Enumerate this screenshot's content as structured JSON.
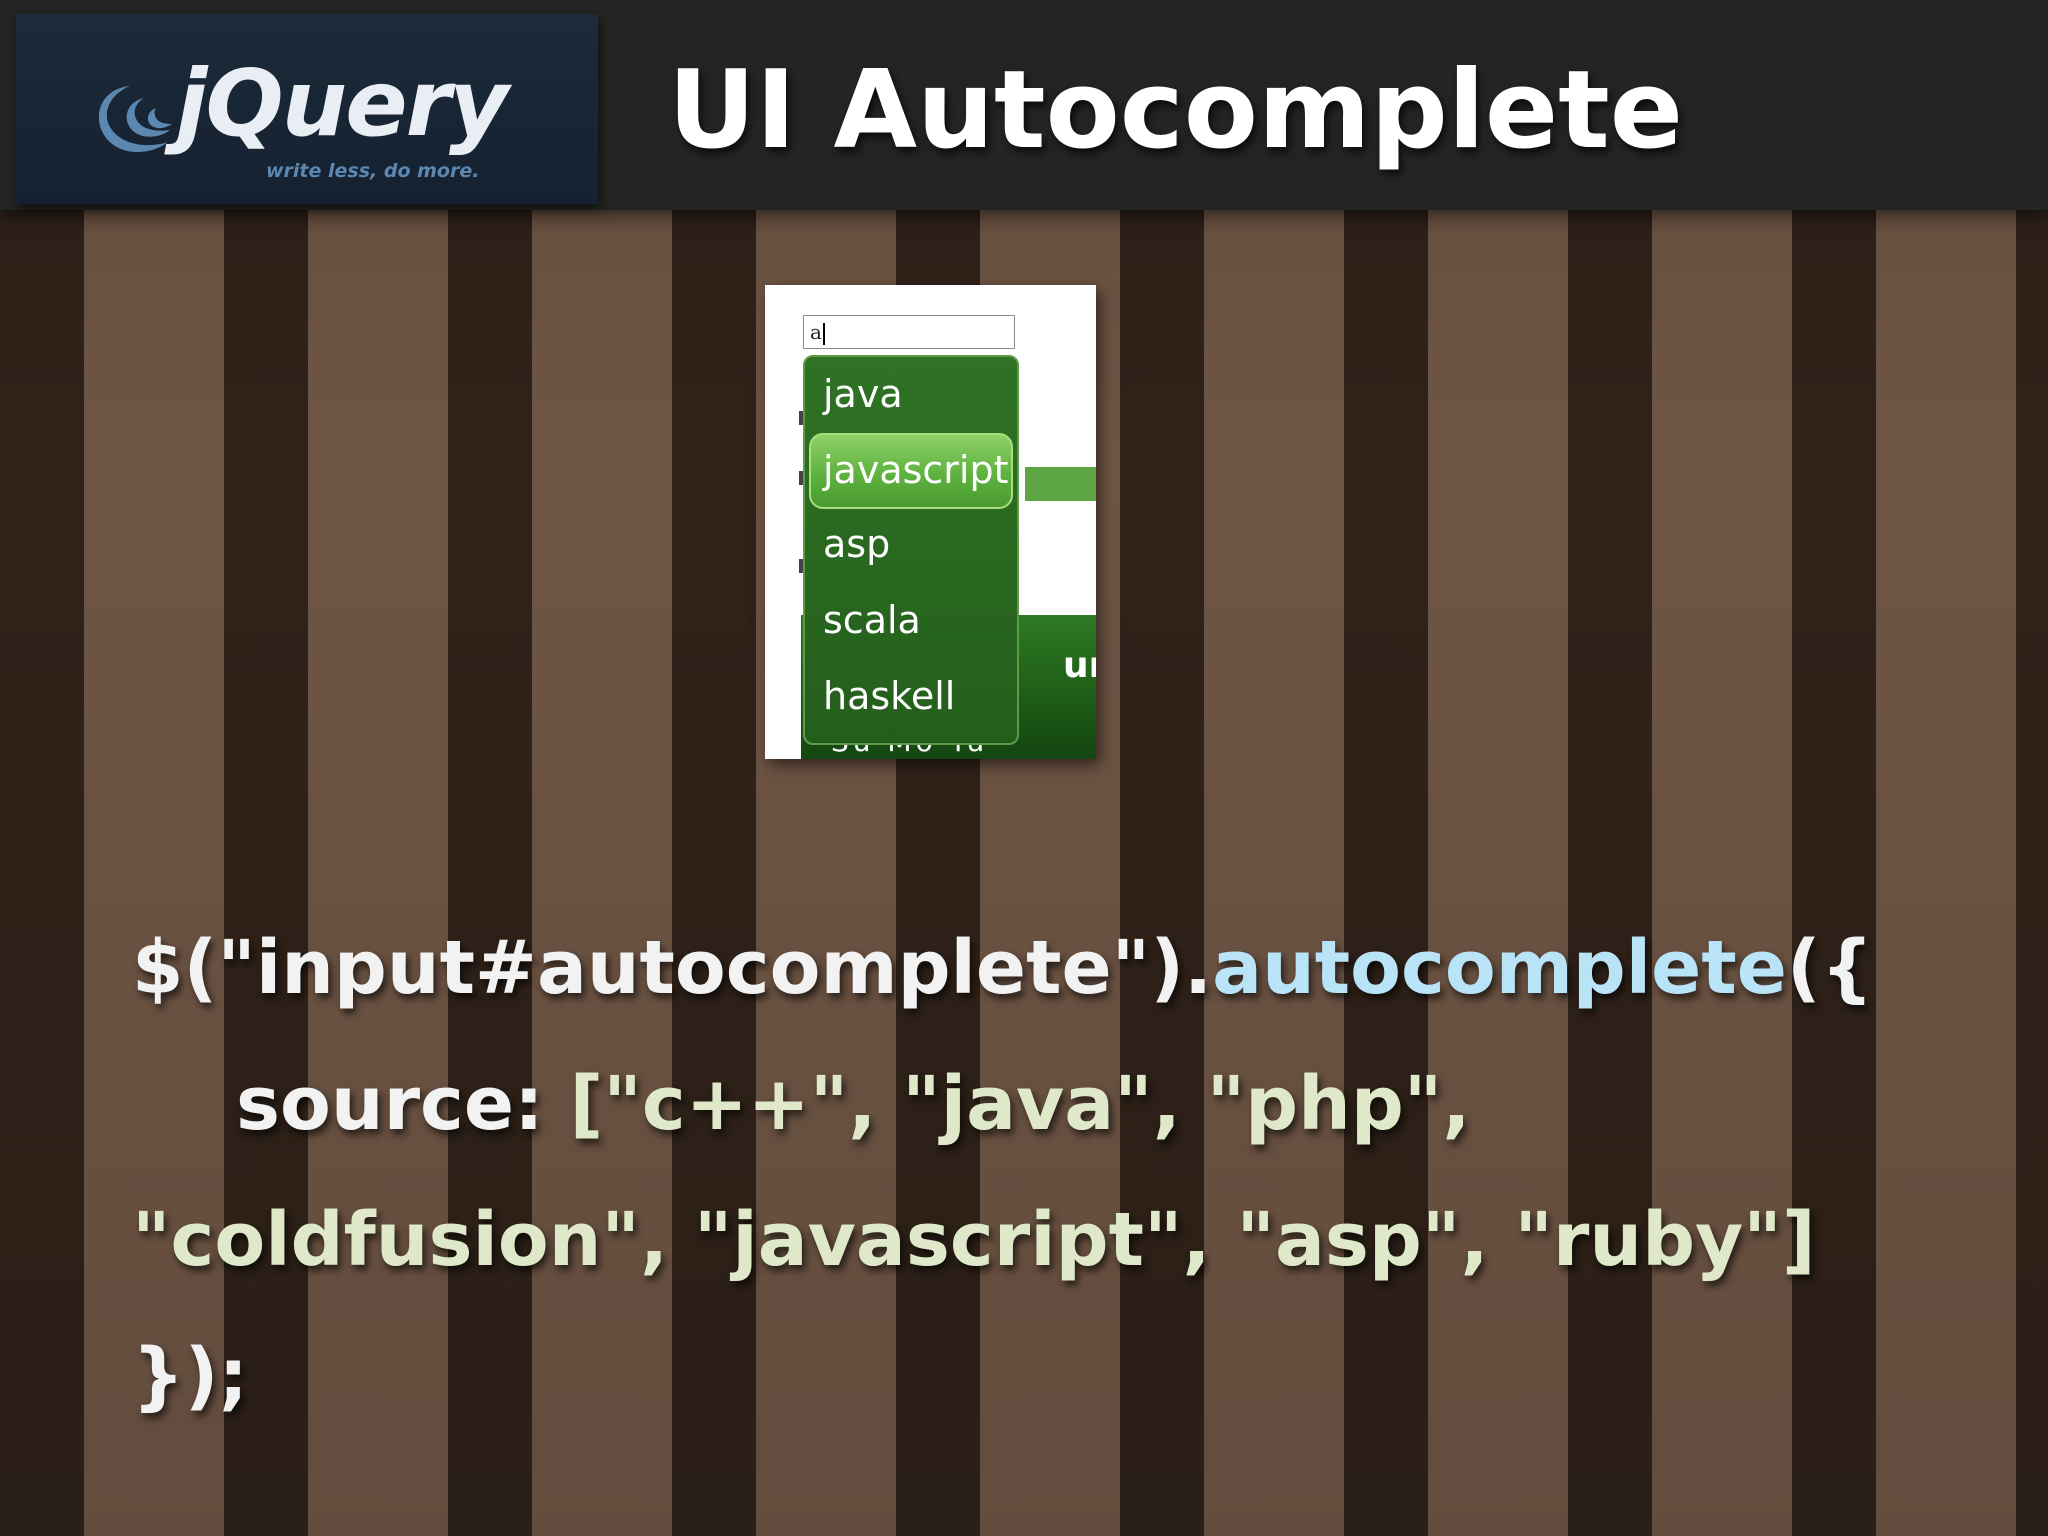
{
  "header": {
    "logo_name": "jQuery",
    "logo_tagline": "write less, do more.",
    "title": "UI Autocomplete"
  },
  "demo": {
    "input_value": "a",
    "menu_items": [
      "java",
      "javascript",
      "asp",
      "scala",
      "haskell"
    ],
    "active_index": 1,
    "background_text_right": "ur",
    "background_text_days": "Su Mo Tu"
  },
  "code": {
    "line1_selector": "$(\"input#autocomplete\").",
    "line1_method": "autocomplete",
    "line1_end": "({",
    "line2_key": "source: ",
    "line2_list": "[\"c++\", \"java\", \"php\",",
    "line3_list": "\"coldfusion\", \"javascript\", \"asp\", \"ruby\"]",
    "line4": "});"
  },
  "colors": {
    "stripe_dark": "#2f2219",
    "stripe_light": "#6e5544",
    "header_bg": "#242422",
    "menu_green": "#2f7225",
    "menu_active": "#5fb23f",
    "code_method": "#b9e3f7",
    "code_string": "#dfe9c9"
  }
}
